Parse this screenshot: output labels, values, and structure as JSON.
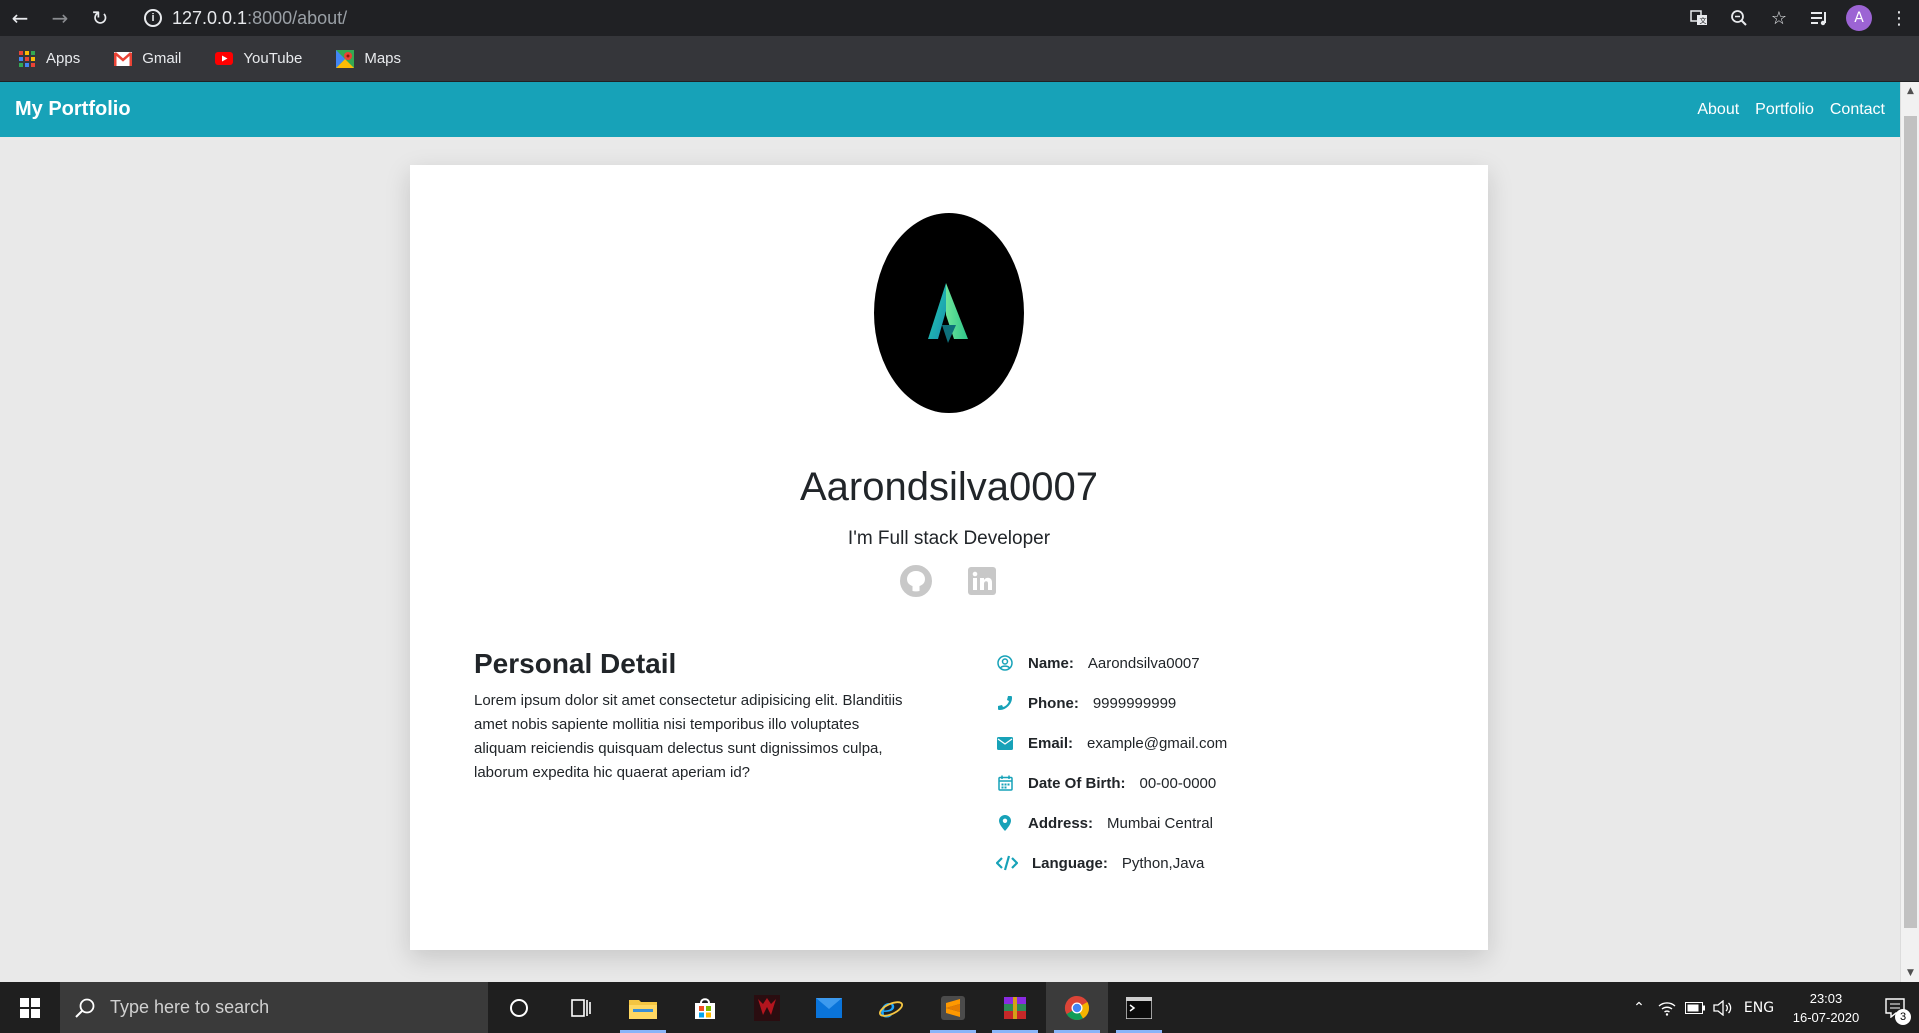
{
  "browser": {
    "url_host": "127.0.0.1",
    "url_path": ":8000/about/",
    "profile_initial": "A",
    "bookmarks": [
      {
        "label": "Apps",
        "icon": "apps-grid-icon"
      },
      {
        "label": "Gmail",
        "icon": "gmail-icon"
      },
      {
        "label": "YouTube",
        "icon": "youtube-icon"
      },
      {
        "label": "Maps",
        "icon": "maps-icon"
      }
    ]
  },
  "navbar": {
    "brand": "My Portfolio",
    "links": [
      "About",
      "Portfolio",
      "Contact"
    ]
  },
  "profile": {
    "logo_letter": "A",
    "name": "Aarondsilva0007",
    "tagline": "I'm Full stack Developer",
    "social": [
      "github-icon",
      "linkedin-icon"
    ]
  },
  "personal_detail": {
    "title": "Personal Detail",
    "text": "Lorem ipsum dolor sit amet consectetur adipisicing elit. Blanditiis amet nobis sapiente mollitia nisi temporibus illo voluptates aliquam reiciendis quisquam delectus sunt dignissimos culpa, laborum expedita hic quaerat aperiam id?"
  },
  "details": [
    {
      "label": "Name:",
      "value": "Aarondsilva0007",
      "icon": "user-circle-icon"
    },
    {
      "label": "Phone:",
      "value": "9999999999",
      "icon": "phone-icon"
    },
    {
      "label": "Email:",
      "value": "example@gmail.com",
      "icon": "envelope-icon"
    },
    {
      "label": "Date Of Birth:",
      "value": "00-00-0000",
      "icon": "calendar-icon"
    },
    {
      "label": "Address:",
      "value": "Mumbai Central",
      "icon": "map-marker-icon"
    },
    {
      "label": "Language:",
      "value": "Python,Java",
      "icon": "code-icon"
    }
  ],
  "colors": {
    "accent": "#17a2b8",
    "navbar_text": "#ffffff"
  },
  "taskbar": {
    "search_placeholder": "Type here to search",
    "language": "ENG",
    "time": "23:03",
    "date": "16-07-2020",
    "notification_count": "3"
  }
}
